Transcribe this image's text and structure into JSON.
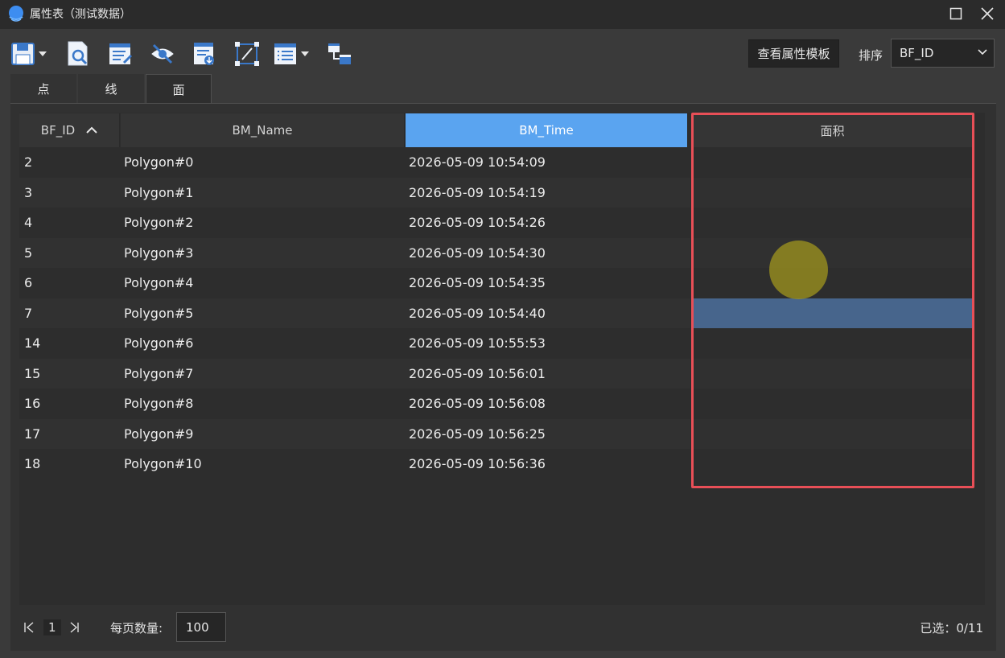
{
  "window": {
    "title": "属性表（测试数据）"
  },
  "toolbar": {
    "icons": [
      "save-icon",
      "query-icon",
      "edit-icon",
      "hide-icon",
      "import-icon",
      "zoom-extent-icon",
      "list-icon",
      "link-icon"
    ],
    "template_button": "查看属性模板",
    "sort_label": "排序",
    "sort_value": "BF_ID"
  },
  "tabs": [
    {
      "label": "点",
      "active": false
    },
    {
      "label": "线",
      "active": false
    },
    {
      "label": "面",
      "active": true
    }
  ],
  "table": {
    "columns": [
      {
        "label": "BF_ID",
        "sorted": "asc"
      },
      {
        "label": "BM_Name"
      },
      {
        "label": "BM_Time",
        "active": true
      },
      {
        "label": "面积"
      }
    ],
    "rows": [
      {
        "id": "2",
        "name": "Polygon#0",
        "time": "2026-05-09 10:54:09",
        "area": ""
      },
      {
        "id": "3",
        "name": "Polygon#1",
        "time": "2026-05-09 10:54:19",
        "area": ""
      },
      {
        "id": "4",
        "name": "Polygon#2",
        "time": "2026-05-09 10:54:26",
        "area": ""
      },
      {
        "id": "5",
        "name": "Polygon#3",
        "time": "2026-05-09 10:54:30",
        "area": ""
      },
      {
        "id": "6",
        "name": "Polygon#4",
        "time": "2026-05-09 10:54:35",
        "area": ""
      },
      {
        "id": "7",
        "name": "Polygon#5",
        "time": "2026-05-09 10:54:40",
        "area": ""
      },
      {
        "id": "14",
        "name": "Polygon#6",
        "time": "2026-05-09 10:55:53",
        "area": ""
      },
      {
        "id": "15",
        "name": "Polygon#7",
        "time": "2026-05-09 10:56:01",
        "area": ""
      },
      {
        "id": "16",
        "name": "Polygon#8",
        "time": "2026-05-09 10:56:08",
        "area": ""
      },
      {
        "id": "17",
        "name": "Polygon#9",
        "time": "2026-05-09 10:56:25",
        "area": ""
      },
      {
        "id": "18",
        "name": "Polygon#10",
        "time": "2026-05-09 10:56:36",
        "area": ""
      }
    ]
  },
  "pagination": {
    "current_page": "1",
    "page_size_label": "每页数量:",
    "page_size": "100",
    "selected": "已选：0/11"
  },
  "colors": {
    "active_header": "#5aa4f0",
    "selected_cell": "#47658c",
    "highlight_box": "#e84f57"
  }
}
